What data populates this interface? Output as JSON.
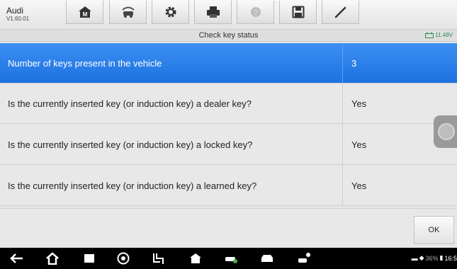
{
  "app": {
    "brand": "Audi",
    "version": "V1.60.01"
  },
  "toolbar": {
    "buttons": [
      "home-icon",
      "vehicle-swap-icon",
      "settings-icon",
      "print-icon",
      "help-icon",
      "save-icon",
      "edit-icon"
    ]
  },
  "header": {
    "title": "Check key status",
    "voltage": "11.48V"
  },
  "rows": [
    {
      "question": "Number of keys present in the vehicle",
      "answer": "3",
      "selected": true
    },
    {
      "question": "Is the currently inserted key (or induction key) a dealer key?",
      "answer": "Yes"
    },
    {
      "question": "Is the currently inserted key (or induction key) a locked key?",
      "answer": "Yes"
    },
    {
      "question": "Is the currently inserted key (or induction key) a learned key?",
      "answer": "Yes"
    }
  ],
  "actions": {
    "ok_label": "OK"
  },
  "status_bar": {
    "battery": "36%",
    "time": "16:5"
  },
  "colors": {
    "selected_row": "#1d72e0",
    "voltage": "#2e8b57"
  }
}
